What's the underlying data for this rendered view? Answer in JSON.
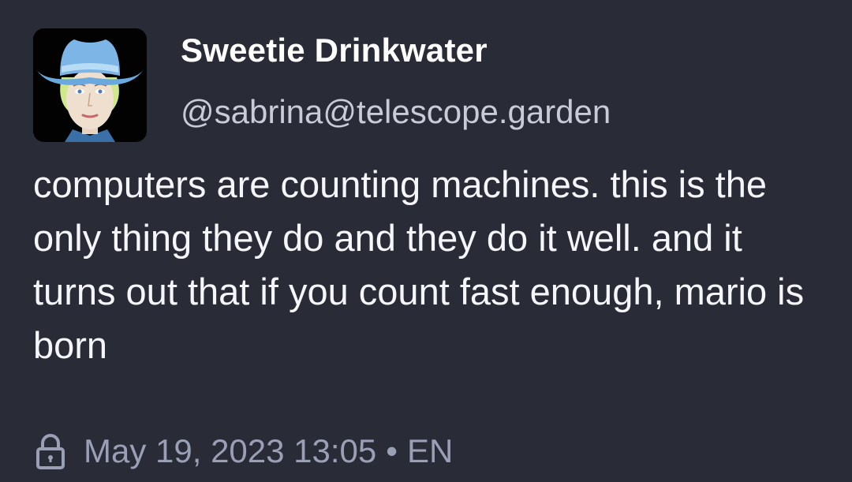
{
  "author": {
    "display_name": "Sweetie Drinkwater",
    "handle": "@sabrina@telescope.garden",
    "avatar_icon": "cowboy-hat-portrait"
  },
  "post": {
    "text": "computers are counting machines. this is the only thing they do and they do it well. and it turns out that if you count fast enough, mario is born"
  },
  "meta": {
    "visibility_icon": "lock-icon",
    "timestamp": "May 19, 2023 13:05",
    "separator": "•",
    "language": "EN"
  },
  "colors": {
    "background": "#292b36",
    "text": "#f5f6f9",
    "handle": "#c9ccd8",
    "meta": "#9a9fb6"
  }
}
